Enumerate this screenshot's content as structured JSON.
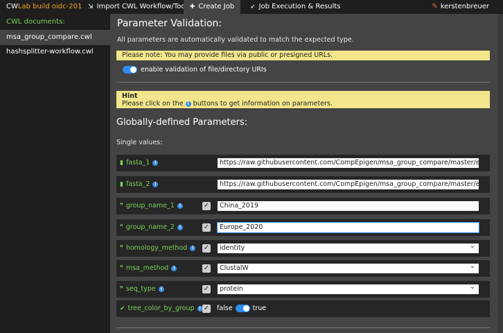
{
  "topbar": {
    "brand_a": "CW",
    "brand_b": "Lab build oidc-201",
    "nav": [
      {
        "label": "Import CWL Workflow/Tool",
        "icon": "import-icon"
      },
      {
        "label": "Create Job",
        "icon": "plus-icon"
      },
      {
        "label": "Job Execution & Results",
        "icon": "rocket-icon"
      }
    ],
    "user": "kerstenbreuer",
    "user_icon": "pen-icon"
  },
  "sidebar": {
    "heading": "CWL documents:",
    "items": [
      {
        "label": "msa_group_compare.cwl",
        "active": true
      },
      {
        "label": "hashsplitter-workflow.cwl",
        "active": false
      }
    ]
  },
  "main": {
    "validation_title": "Parameter Validation:",
    "auto_note": "All parameters are automatically validated to match the expected type.",
    "presigned_note": "Please note: You may provide files via public or presigned URLs.",
    "uri_toggle_label": "enable validation of file/directory URIs",
    "hint_title": "Hint",
    "hint_text_before": "Please click on the",
    "hint_text_after": "buttons to get information on parameters.",
    "global_title": "Globally-defined Parameters:",
    "single_values": "Single values:"
  },
  "params": [
    {
      "name": "fasta_1",
      "icon": "file-icon",
      "value": "https://raw.githubusercontent.com/CompEpigen/msa_group_compare/master/example"
    },
    {
      "name": "fasta_2",
      "icon": "file-icon",
      "value": "https://raw.githubusercontent.com/CompEpigen/msa_group_compare/master/example"
    },
    {
      "name": "group_name_1",
      "icon": "quote-icon",
      "value": "China_2019"
    },
    {
      "name": "group_name_2",
      "icon": "quote-icon",
      "value": "Europe_2020"
    },
    {
      "name": "homology_method",
      "icon": "quote-icon",
      "value": "identity"
    },
    {
      "name": "msa_method",
      "icon": "quote-icon",
      "value": "ClustalW"
    },
    {
      "name": "seq_type",
      "icon": "quote-icon",
      "value": "protein"
    },
    {
      "name": "tree_color_by_group",
      "icon": "check-icon",
      "false_label": "false",
      "true_label": "true"
    }
  ],
  "colors": {
    "accent_green": "#7ed05a",
    "note_yellow": "#f3e58b",
    "toggle_blue": "#2d8cf0",
    "brand_orange": "#f0a020"
  }
}
